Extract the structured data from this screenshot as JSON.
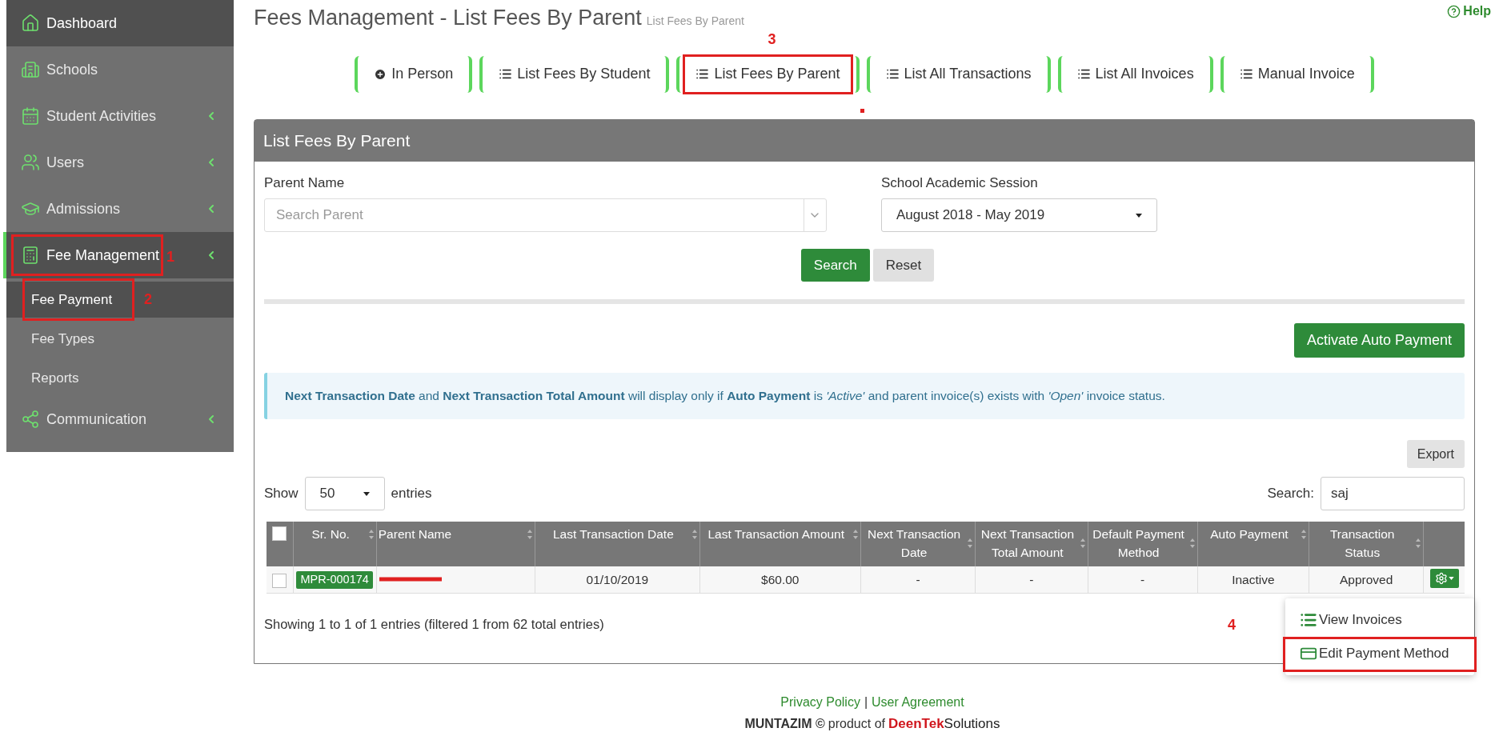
{
  "sidebar": {
    "items": [
      {
        "label": "Dashboard",
        "selected": true,
        "expandable": false
      },
      {
        "label": "Schools",
        "selected": false,
        "expandable": false
      },
      {
        "label": "Student Activities",
        "selected": false,
        "expandable": true
      },
      {
        "label": "Users",
        "selected": false,
        "expandable": true
      },
      {
        "label": "Admissions",
        "selected": false,
        "expandable": true
      },
      {
        "label": "Fee Management",
        "selected": true,
        "expandable": true,
        "expanded": true,
        "annotation": "1",
        "children": [
          {
            "label": "Fee Payment",
            "selected": true,
            "annotation": "2"
          },
          {
            "label": "Fee Types",
            "selected": false
          },
          {
            "label": "Reports",
            "selected": false
          }
        ]
      },
      {
        "label": "Communication",
        "selected": false,
        "expandable": true
      }
    ]
  },
  "page": {
    "title": "Fees Management - List Fees By Parent",
    "subtitle": "List Fees By Parent",
    "help": "Help"
  },
  "tabs": [
    {
      "label": "In Person"
    },
    {
      "label": "List Fees By Student"
    },
    {
      "label": "List Fees By Parent",
      "annotation": "3"
    },
    {
      "label": "List All Transactions"
    },
    {
      "label": "List All Invoices"
    },
    {
      "label": "Manual Invoice"
    }
  ],
  "panel": {
    "title": "List Fees By Parent",
    "parent_name": {
      "label": "Parent Name",
      "placeholder": "Search Parent"
    },
    "session": {
      "label": "School Academic Session",
      "value": "August 2018 - May 2019"
    },
    "buttons": [
      "Search",
      "Reset"
    ],
    "activate_button": "Activate Auto Payment",
    "info": "**Next Transaction Date** and **Next Transaction Total Amount** will display only if **Auto Payment** is *'Active'* and parent invoice(s) exists with *'Open'* invoice status.",
    "export": "Export",
    "show": {
      "before": "Show",
      "value": "50",
      "after": "entries"
    },
    "search": {
      "label": "Search:",
      "value": "saj"
    },
    "table": {
      "all_checked": false,
      "columns": [
        "Sr. No.",
        "Parent Name",
        "Last Transaction Date",
        "Last Transaction Amount",
        "Next Transaction Date",
        "Next Transaction Total Amount",
        "Default Payment Method",
        "Auto Payment",
        "Transaction Status"
      ],
      "rows": [
        {
          "checked": false,
          "cells": [
            "MPR-000174",
            "",
            "01/10/2019",
            "$60.00",
            "-",
            "-",
            "-",
            "Inactive",
            "Approved"
          ],
          "redacted": true
        }
      ]
    },
    "summary": "Showing 1 to 1 of 1 entries (filtered 1 from 62 total entries)",
    "action_menu": [
      {
        "label": "View Invoices"
      },
      {
        "label": "Edit Payment Method",
        "annotation": "4"
      }
    ]
  },
  "footer": {
    "links": [
      "Privacy Policy",
      "User Agreement"
    ],
    "separator": "|",
    "brand": "MUNTAZIM ©",
    "product": "product of",
    "logo_a": "DeenTek",
    "logo_b": "Solutions"
  }
}
